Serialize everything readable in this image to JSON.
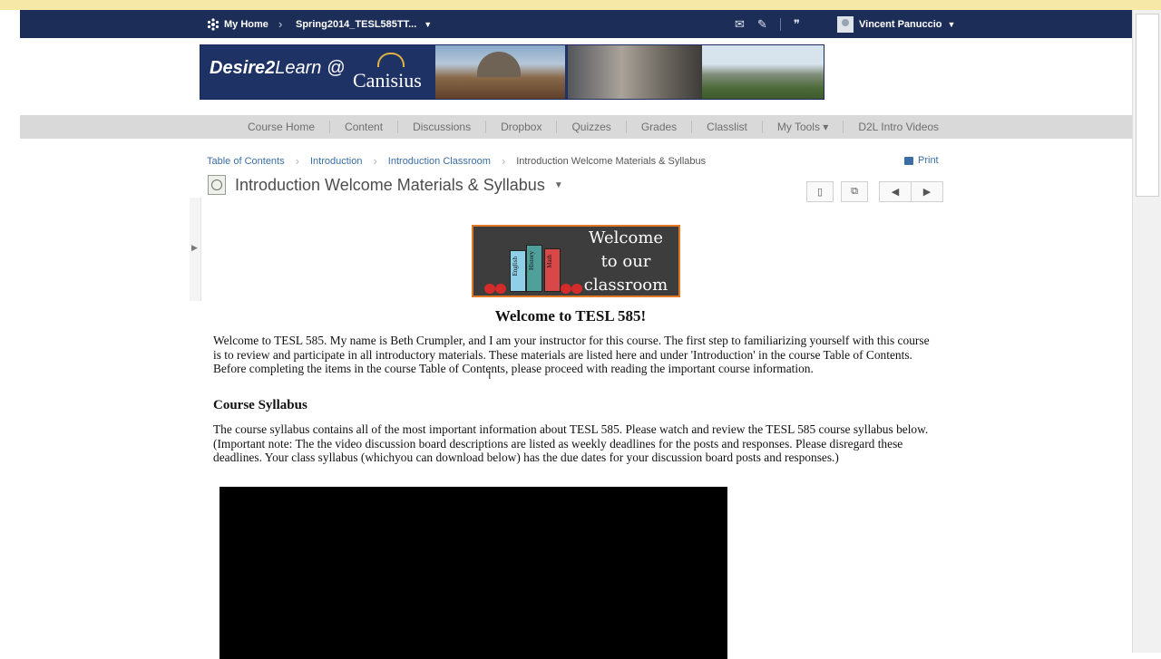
{
  "topbar": {
    "home_label": "My Home",
    "course_label": "Spring2014_TESL585TT...",
    "user_name": "Vincent Panuccio",
    "icons": [
      "mail-icon",
      "updates-icon",
      "chat-icon"
    ]
  },
  "banner": {
    "logo_main": "Desire2",
    "logo_sub": "Learn",
    "at": "@",
    "school": "Canisius"
  },
  "nav": {
    "items": [
      "Course Home",
      "Content",
      "Discussions",
      "Dropbox",
      "Quizzes",
      "Grades",
      "Classlist",
      "My Tools ▾",
      "D2L Intro Videos"
    ]
  },
  "breadcrumbs": {
    "items": [
      "Table of Contents",
      "Introduction",
      "Introduction Classroom"
    ],
    "current": "Introduction Welcome Materials & Syllabus",
    "print_label": "Print"
  },
  "topic": {
    "title": "Introduction Welcome Materials & Syllabus"
  },
  "welcome_image": {
    "books": [
      "English",
      "History",
      "Math"
    ],
    "text_line1": "Welcome",
    "text_line2": "to our",
    "text_line3": "classroom"
  },
  "content": {
    "heading": "Welcome to TESL 585!",
    "intro": " Welcome to TESL 585.  My name is Beth Crumpler, and I am your instructor for this course.  The first step to familiarizing yourself with this course is to review and participate in all introductory materials.  These materials are listed here and under 'Introduction' in the course Table of Contents.  Before completing the items in the course Table of Contents, please proceed with reading the important course information.",
    "syllabus_heading": "Course Syllabus",
    "syllabus_text": "The course syllabus contains all of the most important information about TESL 585.  Please watch and review the TESL 585 course syllabus below.  (Important note: The  the video discussion board descriptions are listed as weekly deadlines for the posts and responses.  Please disregard these deadlines.  Your class syllabus (whichyou can download below) has the due dates for your discussion board posts and responses.)"
  },
  "colors": {
    "topbar": "#1c2d57",
    "link": "#3a6ea5",
    "navbar": "#d9d9d9",
    "image_border": "#e27a25"
  }
}
